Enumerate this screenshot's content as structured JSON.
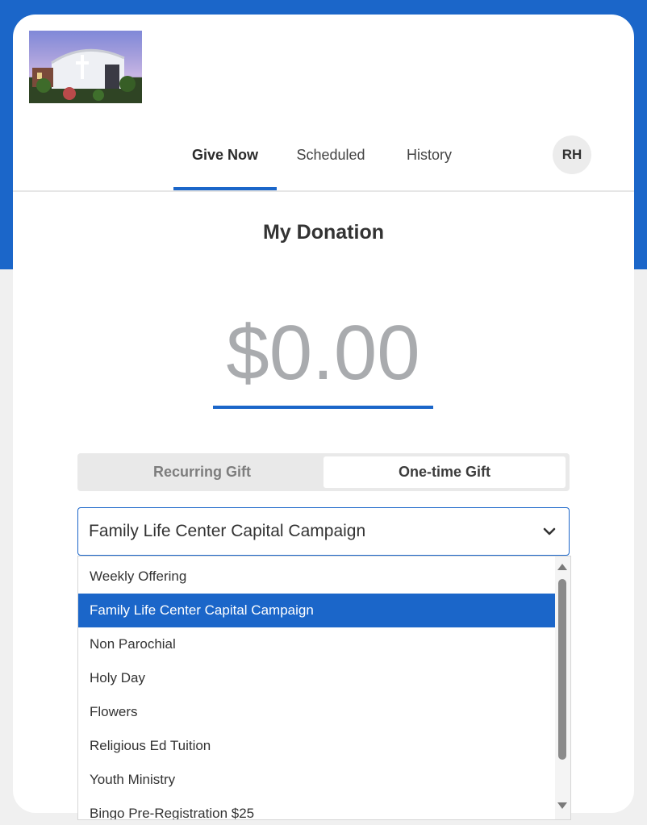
{
  "nav": {
    "tabs": [
      {
        "label": "Give Now",
        "active": true
      },
      {
        "label": "Scheduled",
        "active": false
      },
      {
        "label": "History",
        "active": false
      }
    ],
    "avatar_initials": "RH"
  },
  "donation": {
    "title": "My Donation",
    "amount": "$0.00"
  },
  "gift_type": {
    "options": [
      "Recurring Gift",
      "One-time Gift"
    ],
    "selected": "One-time Gift"
  },
  "fund": {
    "selected": "Family Life Center Capital Campaign",
    "options": [
      "Weekly Offering",
      "Family Life Center Capital Campaign",
      "Non Parochial",
      "Holy Day",
      "Flowers",
      "Religious Ed Tuition",
      "Youth Ministry",
      "Bingo Pre-Registration $25"
    ]
  },
  "colors": {
    "accent": "#1b66c9",
    "amount_text": "#a9abae",
    "background": "#f0f0f0"
  },
  "icons": {
    "logo": "church-photo-logo",
    "select": "chevron-down-icon",
    "scroll_up": "scroll-up-arrow",
    "scroll_down": "scroll-down-arrow"
  }
}
